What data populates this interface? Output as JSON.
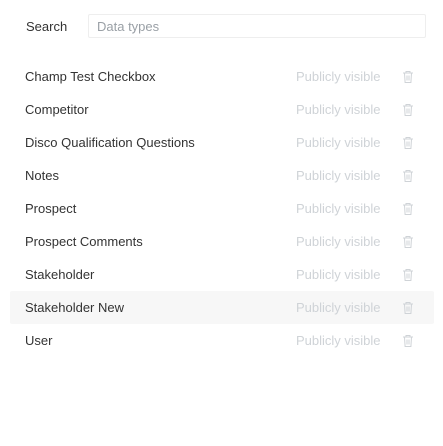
{
  "search": {
    "label": "Search",
    "placeholder": "Data types",
    "value": ""
  },
  "data_types": [
    {
      "name": "Champ Test Checkbox",
      "visibility": "Publicly visible",
      "icon": "trash-icon"
    },
    {
      "name": "Competitor",
      "visibility": "Publicly visible",
      "icon": "trash-icon"
    },
    {
      "name": "Disco Qualification Questions",
      "visibility": "Publicly visible",
      "icon": "trash-icon"
    },
    {
      "name": "Notes",
      "visibility": "Publicly visible",
      "icon": "trash-icon"
    },
    {
      "name": "Prospect",
      "visibility": "Publicly visible",
      "icon": "trash-icon"
    },
    {
      "name": "Prospect Comments",
      "visibility": "Publicly visible",
      "icon": "trash-icon"
    },
    {
      "name": "Stakeholder",
      "visibility": "Publicly visible",
      "icon": "trash-icon"
    },
    {
      "name": "Stakeholder New",
      "visibility": "Publicly visible",
      "icon": "trash-icon"
    },
    {
      "name": "User",
      "visibility": "Publicly visible",
      "icon": "trash-icon"
    }
  ],
  "colors": {
    "text": "#333333",
    "muted": "#cfd3d7",
    "hover_row": "#f7f7f7"
  }
}
